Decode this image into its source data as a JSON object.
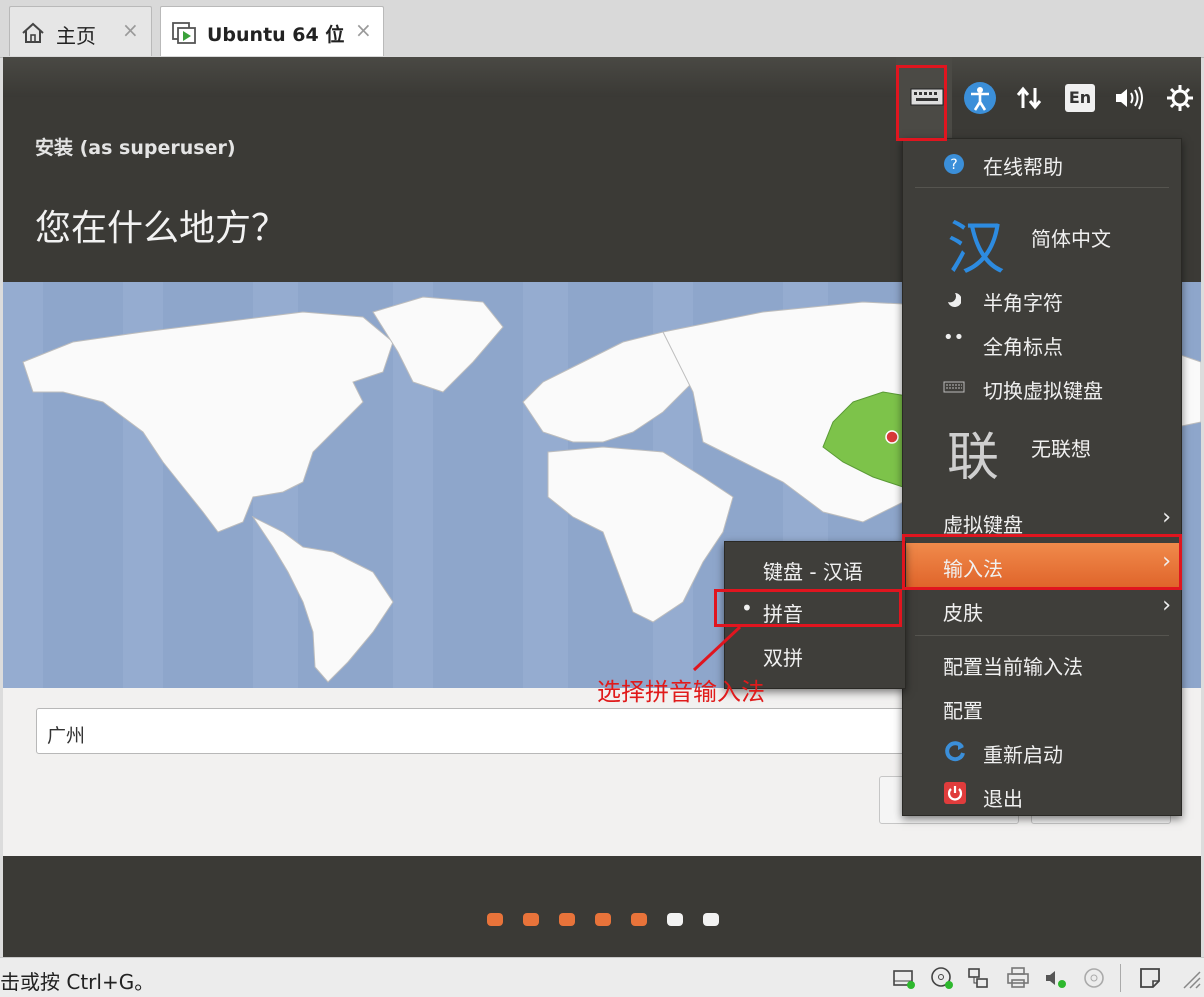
{
  "tabs": [
    {
      "label": "主页",
      "close": "×"
    },
    {
      "label": "Ubuntu 64 位",
      "close": "×"
    }
  ],
  "installer": {
    "small_title": "安装 (as superuser)",
    "heading": "您在什么地方？",
    "city_value": "广州",
    "progress_dots": [
      "#e8733a",
      "#e8733a",
      "#e8733a",
      "#e8733a",
      "#e8733a",
      "#f2f2f2",
      "#f2f2f2"
    ]
  },
  "panel": {
    "lang_indicator": "En"
  },
  "fcitx_menu": {
    "online_help": "在线帮助",
    "big_han": "汉",
    "simplified": "简体中文",
    "half_width": "半角字符",
    "full_punct": "全角标点",
    "toggle_vk": "切换虚拟键盘",
    "big_lian": "联",
    "no_predict": "无联想",
    "virtual_keyboard": "虚拟键盘",
    "input_method": "输入法",
    "skin": "皮肤",
    "configure_current": "配置当前输入法",
    "configure": "配置",
    "restart": "重新启动",
    "exit": "退出"
  },
  "input_submenu": {
    "items": [
      "键盘 - 汉语",
      "拼音",
      "双拼"
    ],
    "selected_bullet": "•"
  },
  "annotation": "选择拼音输入法",
  "status_bar": {
    "text": "击或按 Ctrl+G。"
  },
  "colors": {
    "accent_orange": "#e8733a",
    "annotation_red": "#e0151f",
    "china_green": "#7dc34a"
  }
}
